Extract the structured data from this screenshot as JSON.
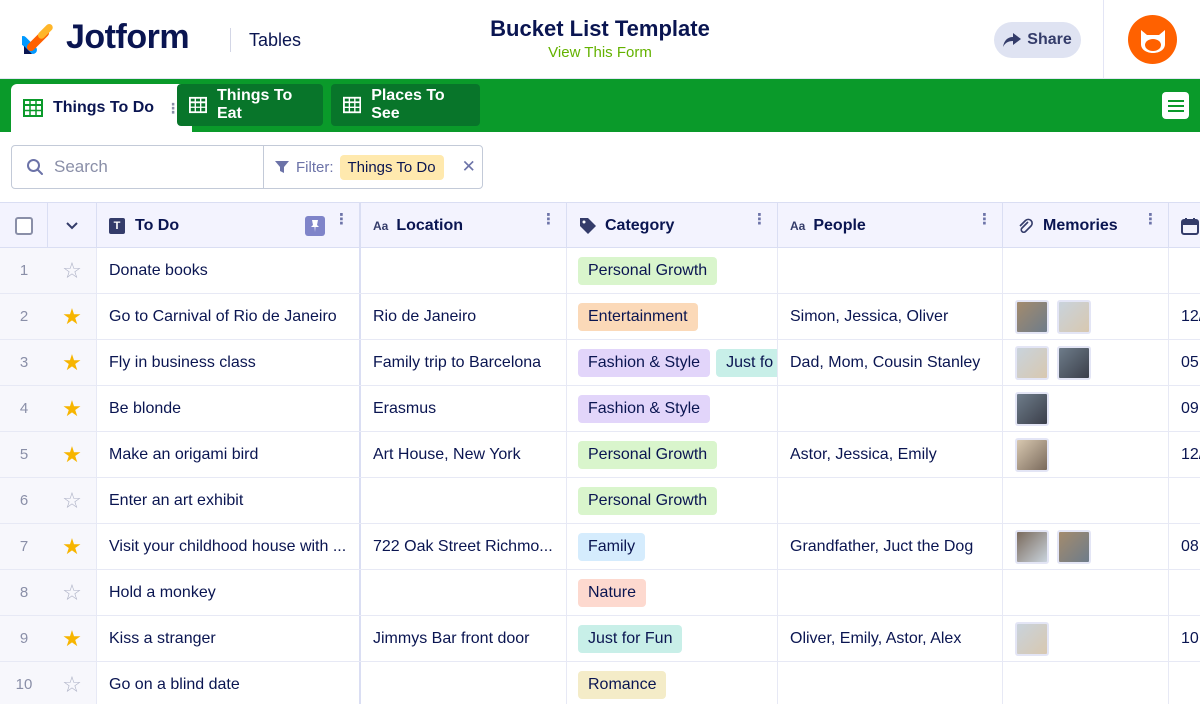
{
  "header": {
    "brand": "Jotform",
    "section": "Tables",
    "title": "Bucket List Template",
    "subtitle": "View This Form",
    "share_label": "Share"
  },
  "tabs": [
    {
      "label": "Things To Do",
      "active": true
    },
    {
      "label": "Things To Eat",
      "active": false
    },
    {
      "label": "Places To See",
      "active": false
    }
  ],
  "toolbar": {
    "search_placeholder": "Search",
    "filter_label": "Filter:",
    "filter_value": "Things To Do"
  },
  "columns": [
    {
      "label": "To Do",
      "icon": "text-field-icon"
    },
    {
      "label": "Location",
      "icon": "short-text-icon"
    },
    {
      "label": "Category",
      "icon": "tag-icon"
    },
    {
      "label": "People",
      "icon": "short-text-icon"
    },
    {
      "label": "Memories",
      "icon": "paperclip-icon"
    }
  ],
  "colors": {
    "green_bar": "#0a9a2a",
    "chip_personal_growth": "#d9f5cc",
    "chip_entertainment": "#fbd9b8",
    "chip_fashion": "#e2d5fa",
    "chip_just_for_fun": "#c8efe8",
    "chip_family": "#d5ecfd",
    "chip_nature": "#fdd9cf",
    "chip_romance": "#f4ecc8",
    "star_on": "#f7b500",
    "star_off": "#aeb2c6"
  },
  "rows": [
    {
      "num": "1",
      "starred": false,
      "todo": "Donate books",
      "location": "",
      "categories": [
        "Personal Growth"
      ],
      "people": "",
      "memories": 0,
      "date": ""
    },
    {
      "num": "2",
      "starred": true,
      "todo": "Go to Carnival of Rio de Janeiro",
      "location": "Rio de Janeiro",
      "categories": [
        "Entertainment"
      ],
      "people": "Simon, Jessica, Oliver",
      "memories": 2,
      "date": "12/"
    },
    {
      "num": "3",
      "starred": true,
      "todo": "Fly in business class",
      "location": "Family trip to Barcelona",
      "categories": [
        "Fashion & Style",
        "Just fo"
      ],
      "people": "Dad, Mom, Cousin Stanley",
      "memories": 2,
      "date": "05"
    },
    {
      "num": "4",
      "starred": true,
      "todo": "Be blonde",
      "location": "Erasmus",
      "categories": [
        "Fashion & Style"
      ],
      "people": "",
      "memories": 1,
      "date": "09"
    },
    {
      "num": "5",
      "starred": true,
      "todo": "Make an origami bird",
      "location": "Art House, New York",
      "categories": [
        "Personal Growth"
      ],
      "people": "Astor, Jessica, Emily",
      "memories": 1,
      "date": "12/"
    },
    {
      "num": "6",
      "starred": false,
      "todo": "Enter an art exhibit",
      "location": "",
      "categories": [
        "Personal Growth"
      ],
      "people": "",
      "memories": 0,
      "date": ""
    },
    {
      "num": "7",
      "starred": true,
      "todo": "Visit your childhood house with ...",
      "location": "722 Oak Street Richmo...",
      "categories": [
        "Family"
      ],
      "people": "Grandfather, Juct the Dog",
      "memories": 2,
      "date": "08"
    },
    {
      "num": "8",
      "starred": false,
      "todo": "Hold a monkey",
      "location": "",
      "categories": [
        "Nature"
      ],
      "people": "",
      "memories": 0,
      "date": ""
    },
    {
      "num": "9",
      "starred": true,
      "todo": "Kiss a stranger",
      "location": "Jimmys Bar front door",
      "categories": [
        "Just for Fun"
      ],
      "people": "Oliver, Emily, Astor, Alex",
      "memories": 1,
      "date": "10."
    },
    {
      "num": "10",
      "starred": false,
      "todo": "Go on a blind date",
      "location": "",
      "categories": [
        "Romance"
      ],
      "people": "",
      "memories": 0,
      "date": ""
    }
  ]
}
